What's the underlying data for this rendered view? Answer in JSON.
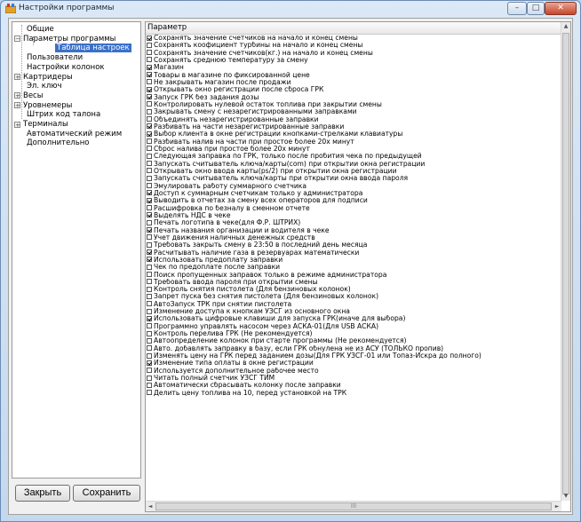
{
  "window": {
    "title": "Настройки программы",
    "controls": {
      "minimize": "–",
      "maximize": "□",
      "close": "✕"
    }
  },
  "tree": {
    "items": [
      {
        "label": "Общие"
      },
      {
        "label": "Параметры программы",
        "expander": "−"
      },
      {
        "label": "Таблица настроек",
        "selected": true
      },
      {
        "label": "Пользователи"
      },
      {
        "label": "Настройки колонок"
      },
      {
        "label": "Картридеры",
        "expander": "+"
      },
      {
        "label": "Эл. ключ"
      },
      {
        "label": "Весы",
        "expander": "+"
      },
      {
        "label": "Уровнемеры",
        "expander": "+"
      },
      {
        "label": "Штрих код талона"
      },
      {
        "label": "Терминалы",
        "expander": "+"
      },
      {
        "label": "Автоматический режим"
      },
      {
        "label": "Дополнительно"
      }
    ]
  },
  "buttons": {
    "close_label": "Закрыть",
    "save_label": "Сохранить"
  },
  "settings": {
    "header": "Параметр",
    "scroll_glyphs": {
      "up": "▲",
      "down": "▼",
      "left": "◄",
      "right": "►",
      "grip": "III"
    },
    "rows": [
      {
        "label": "Сохранять значение счетчиков на начало и конец смены",
        "checked": true
      },
      {
        "label": "Сохранять коофициент турбины на начало и конец смены",
        "checked": false
      },
      {
        "label": "Сохранять значение счетчиков(кг.) на начало и конец смены",
        "checked": false
      },
      {
        "label": "Сохранять среднюю температуру за смену",
        "checked": false
      },
      {
        "label": "Магазин",
        "checked": true
      },
      {
        "label": "Товары в магазине по фиксированной цене",
        "checked": true
      },
      {
        "label": "Не закрывать магазин после продажи",
        "checked": false
      },
      {
        "label": "Открывать окно регистрации после сброса ГРК",
        "checked": true
      },
      {
        "label": "Запуск ГРК без задания дозы",
        "checked": true
      },
      {
        "label": "Контролировать нулевой остаток топлива при закрытии смены",
        "checked": false
      },
      {
        "label": "Закрывать смену с незарегистрированными заправками",
        "checked": false
      },
      {
        "label": "Объединять незарегистрированные заправки",
        "checked": false
      },
      {
        "label": "Разбивать на части незарегистрированные заправки",
        "checked": true
      },
      {
        "label": "Выбор клиента в окне регистрации кнопками-стрелками клавиатуры",
        "checked": true
      },
      {
        "label": "Разбивать налив на части при простое более 20х минут",
        "checked": false
      },
      {
        "label": "Сброс налива при простое более 20х минут",
        "checked": false
      },
      {
        "label": "Следующая заправка по ГРК, только после пробития чека по предыдущей",
        "checked": false
      },
      {
        "label": "Запускать считыватель ключа/карты(com) при открытии окна регистрации",
        "checked": false
      },
      {
        "label": "Открывать окно ввода карты(ps/2) при открытии окна регистрации",
        "checked": false
      },
      {
        "label": "Запускать считыватель ключа/карты при открытии окна ввода пароля",
        "checked": false
      },
      {
        "label": "Эмулировать работу суммарного счетчика",
        "checked": false
      },
      {
        "label": "Доступ к суммарным счетчикам только у администратора",
        "checked": true
      },
      {
        "label": "Выводить в отчетах за смену всех операторов для подписи",
        "checked": true
      },
      {
        "label": "Расшифровка по безналу в сменном отчете",
        "checked": false
      },
      {
        "label": "Выделять НДС в чеке",
        "checked": true
      },
      {
        "label": "Печать логотипа в чеке(для Ф.Р. ШТРИХ)",
        "checked": false
      },
      {
        "label": "Печать названия организации и водителя в чеке",
        "checked": true
      },
      {
        "label": "Учет движения наличных денежных средств",
        "checked": false
      },
      {
        "label": "Требовать закрыть смену в 23:50 в последний день месяца",
        "checked": false
      },
      {
        "label": "Расчитывать наличие газа в резервуарах математически",
        "checked": true
      },
      {
        "label": "Использовать предоплату заправки",
        "checked": true
      },
      {
        "label": "Чек по предоплате после заправки",
        "checked": false
      },
      {
        "label": "Поиск пропущенных заправок только в режиме администратора",
        "checked": false
      },
      {
        "label": "Требовать ввода пароля при открытии смены",
        "checked": false
      },
      {
        "label": "Контроль снятия пистолета (Для бензиновых колонок)",
        "checked": false
      },
      {
        "label": "Запрет пуска без снятия пистолета (Для бензиновых колонок)",
        "checked": false
      },
      {
        "label": "АвтоЗапуск ТРК при снятии пистолета",
        "checked": false
      },
      {
        "label": "Изменение доступа к кнопкам УЗСГ из основного окна",
        "checked": false
      },
      {
        "label": "Использовать цифровые клавиши для запуска ГРК(иначе для выбора)",
        "checked": true
      },
      {
        "label": "Программно управлять насосом через АСКА-01(Для USB АСКА)",
        "checked": false
      },
      {
        "label": "Контроль перелива ГРК (Не рекомендуется)",
        "checked": false
      },
      {
        "label": "Автоопределение колонок при старте программы (Не рекомендуется)",
        "checked": false
      },
      {
        "label": "Авто. добавлять заправку в базу, если ГРК обнулена не из АСУ (ТОЛЬКО пропив)",
        "checked": false
      },
      {
        "label": "Изменять цену на ГРК перед заданием дозы(Для ГРК УЗСГ-01 или  Топаз-Искра до полного)",
        "checked": false
      },
      {
        "label": "Изменение типа оплаты в окне регистрации",
        "checked": true
      },
      {
        "label": "Используется дополнительное рабочее место",
        "checked": false
      },
      {
        "label": "Читать полный счетчик УЗСГ ТИМ",
        "checked": false
      },
      {
        "label": "Автоматически сбрасывать колонку после заправки",
        "checked": false
      },
      {
        "label": "Делить цену топлива на 10, перед установкой на ТРК",
        "checked": false
      }
    ]
  }
}
